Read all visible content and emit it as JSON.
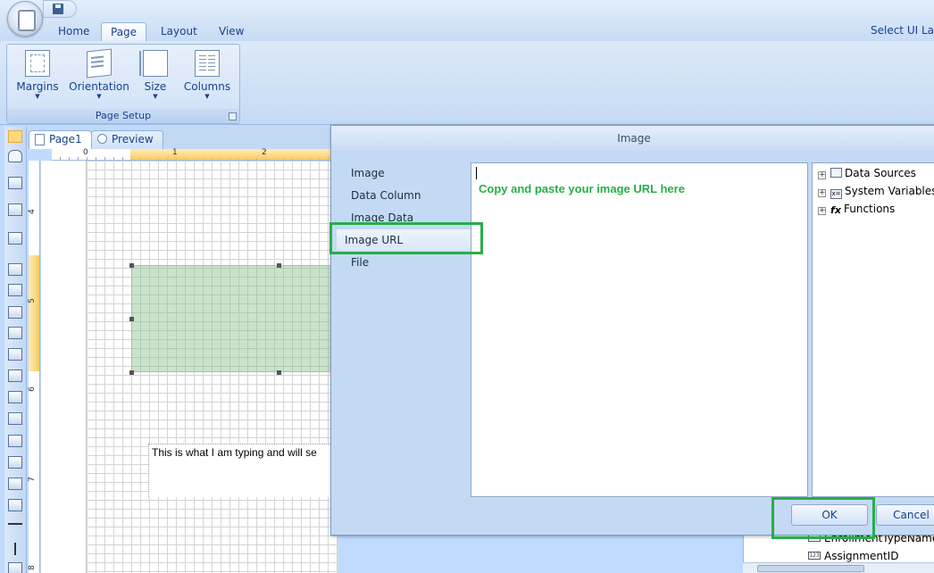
{
  "qat": {
    "save_icon": "save-icon"
  },
  "ribbon": {
    "tabs": [
      {
        "label": "Home"
      },
      {
        "label": "Page",
        "active": true
      },
      {
        "label": "Layout"
      },
      {
        "label": "View"
      }
    ],
    "right_text": "Select UI La",
    "page_setup": {
      "group_label": "Page Setup",
      "buttons": [
        {
          "label": "Margins",
          "icon": "margins-icon"
        },
        {
          "label": "Orientation",
          "icon": "orientation-icon"
        },
        {
          "label": "Size",
          "icon": "size-icon"
        },
        {
          "label": "Columns",
          "icon": "columns-icon"
        }
      ]
    }
  },
  "doc_tabs": [
    {
      "label": "Page1",
      "active": true
    },
    {
      "label": "Preview"
    }
  ],
  "rulers": {
    "horizontal": [
      "0",
      "1",
      "2"
    ],
    "vertical": [
      "4",
      "5",
      "6",
      "7",
      "8"
    ]
  },
  "canvas": {
    "typed_text": "This is what I am typing and will se"
  },
  "background_fields": [
    "EnrollmentTypeName",
    "AssignmentID"
  ],
  "dialog": {
    "title": "Image",
    "nav": [
      "Image",
      "Data Column",
      "Image Data",
      "Image URL",
      "File"
    ],
    "selected_nav": "Image URL",
    "url_value": "",
    "hint": "Copy and paste your image URL here",
    "tree": [
      "Data Sources",
      "System Variables",
      "Functions"
    ],
    "ok_label": "OK",
    "cancel_label": "Cancel"
  },
  "colors": {
    "highlight": "#27ae4a",
    "ribbon": "#c4daf4",
    "text": "#15428b"
  }
}
